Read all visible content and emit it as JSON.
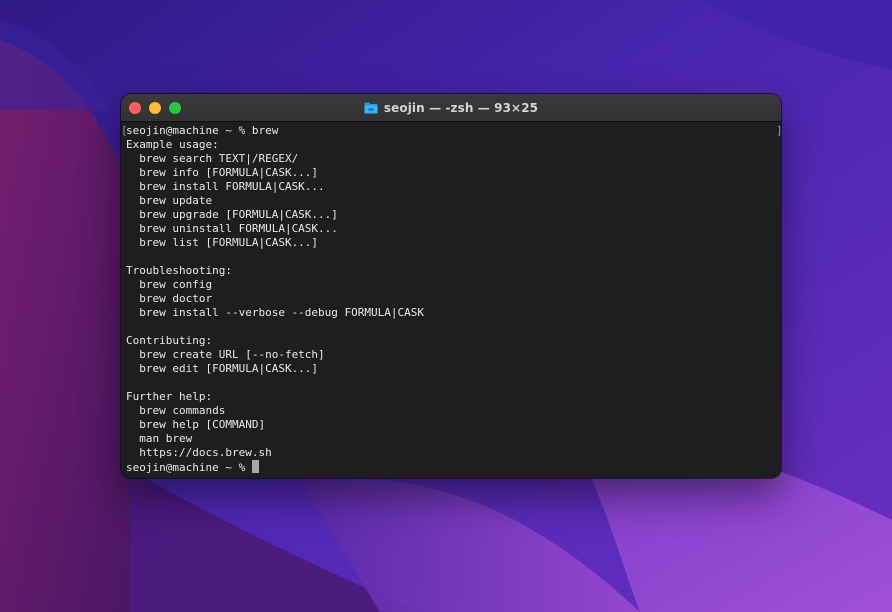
{
  "desktop": {
    "wallpaper_colors": [
      "#3a1f9e",
      "#5b2bb8",
      "#8a3fc4",
      "#4a1660",
      "#7a1f6e"
    ]
  },
  "window": {
    "title": "seojin — -zsh — 93×25",
    "title_icon": "folder-icon",
    "traffic_lights": {
      "close_color": "#ff5f57",
      "minimize_color": "#febc2e",
      "zoom_color": "#28c840"
    }
  },
  "terminal": {
    "background": "#1e1e1e",
    "text_color": "#e8e8e8",
    "cursor_color": "#a8a8a8",
    "left_marker": "[",
    "right_marker": "]",
    "lines": [
      "seojin@machine ~ % brew",
      "Example usage:",
      "  brew search TEXT|/REGEX/",
      "  brew info [FORMULA|CASK...]",
      "  brew install FORMULA|CASK...",
      "  brew update",
      "  brew upgrade [FORMULA|CASK...]",
      "  brew uninstall FORMULA|CASK...",
      "  brew list [FORMULA|CASK...]",
      "",
      "Troubleshooting:",
      "  brew config",
      "  brew doctor",
      "  brew install --verbose --debug FORMULA|CASK",
      "",
      "Contributing:",
      "  brew create URL [--no-fetch]",
      "  brew edit [FORMULA|CASK...]",
      "",
      "Further help:",
      "  brew commands",
      "  brew help [COMMAND]",
      "  man brew",
      "  https://docs.brew.sh"
    ],
    "prompt": "seojin@machine ~ % "
  }
}
